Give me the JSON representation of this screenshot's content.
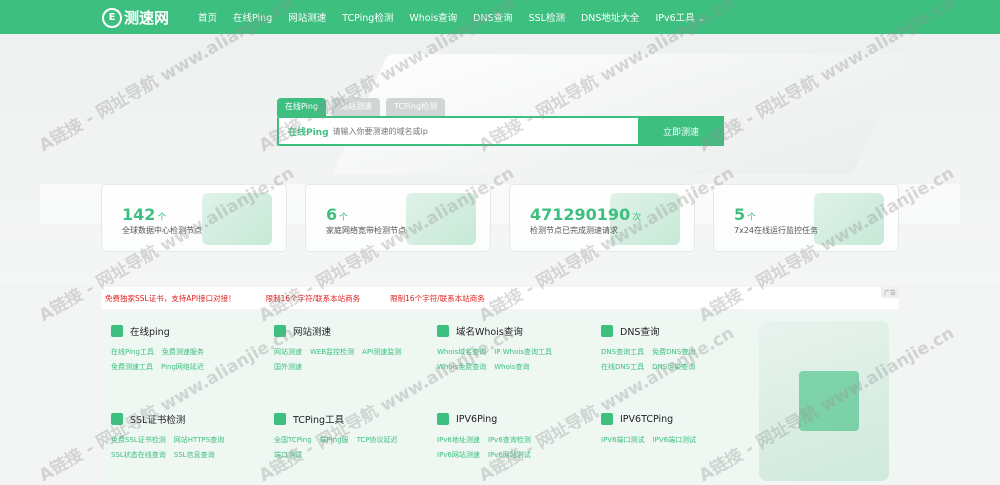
{
  "nav": {
    "logo": "测速网",
    "links": [
      "首页",
      "在线Ping",
      "网站测速",
      "TCPing检测",
      "Whois查询",
      "DNS查询",
      "SSL检测",
      "DNS地址大全",
      "IPv6工具"
    ]
  },
  "search": {
    "tabs": [
      "在线Ping",
      "网站测速",
      "TCPing检测"
    ],
    "mode": "在线Ping",
    "placeholder": "请输入你要测速的域名或ip",
    "button": "立即测速"
  },
  "stats": [
    {
      "num": "142",
      "unit": "个",
      "desc": "全球数据中心检测节点"
    },
    {
      "num": "6",
      "unit": "个",
      "desc": "家庭网络宽带检测节点"
    },
    {
      "num": "471290190",
      "unit": "次",
      "desc": "检测节点已完成测速请求"
    },
    {
      "num": "5",
      "unit": "个",
      "desc": "7x24在线运行监控任务"
    }
  ],
  "ads": [
    "免费独家SSL证书，支持API接口对接！",
    "限制16个字符/联系本站商务",
    "限制16个字符/联系本站商务"
  ],
  "ad_tag": "广告",
  "services": [
    {
      "title": "在线ping",
      "links": [
        "在线Ping工具",
        "免费测速服务",
        "免费测速工具",
        "Ping网络延迟"
      ]
    },
    {
      "title": "网站测速",
      "links": [
        "网站测速",
        "WEB监控检测",
        "API测速监测",
        "国外测速"
      ]
    },
    {
      "title": "域名Whois查询",
      "links": [
        "Whois域名查询",
        "IP Whois查询工具",
        "Whois免费查询",
        "Whois查询"
      ]
    },
    {
      "title": "DNS查询",
      "links": [
        "DNS查询工具",
        "免费DNS查询",
        "在线DNS工具",
        "DNS污染查询"
      ]
    },
    {
      "title": "SSL证书检测",
      "links": [
        "免费SSL证书检测",
        "网站HTTPS查询",
        "SSL状态在线查询",
        "SSL信息查询"
      ]
    },
    {
      "title": "TCPing工具",
      "links": [
        "全国TCPing",
        "端Ping服",
        "TCP协议延迟",
        "端口测试"
      ]
    },
    {
      "title": "IPV6Ping",
      "links": [
        "IPv6地址测速",
        "IPv6查询检测",
        "IPv6网站测速",
        "IPv6网站测试"
      ]
    },
    {
      "title": "IPV6TCPing",
      "links": [
        "IPV6端口测试",
        "IPV6端口测试"
      ]
    }
  ],
  "watermark": "A链接 - 网址导航  www.alianjie.cn",
  "colors": {
    "brand": "#3dbf80",
    "ad": "#e02020"
  }
}
